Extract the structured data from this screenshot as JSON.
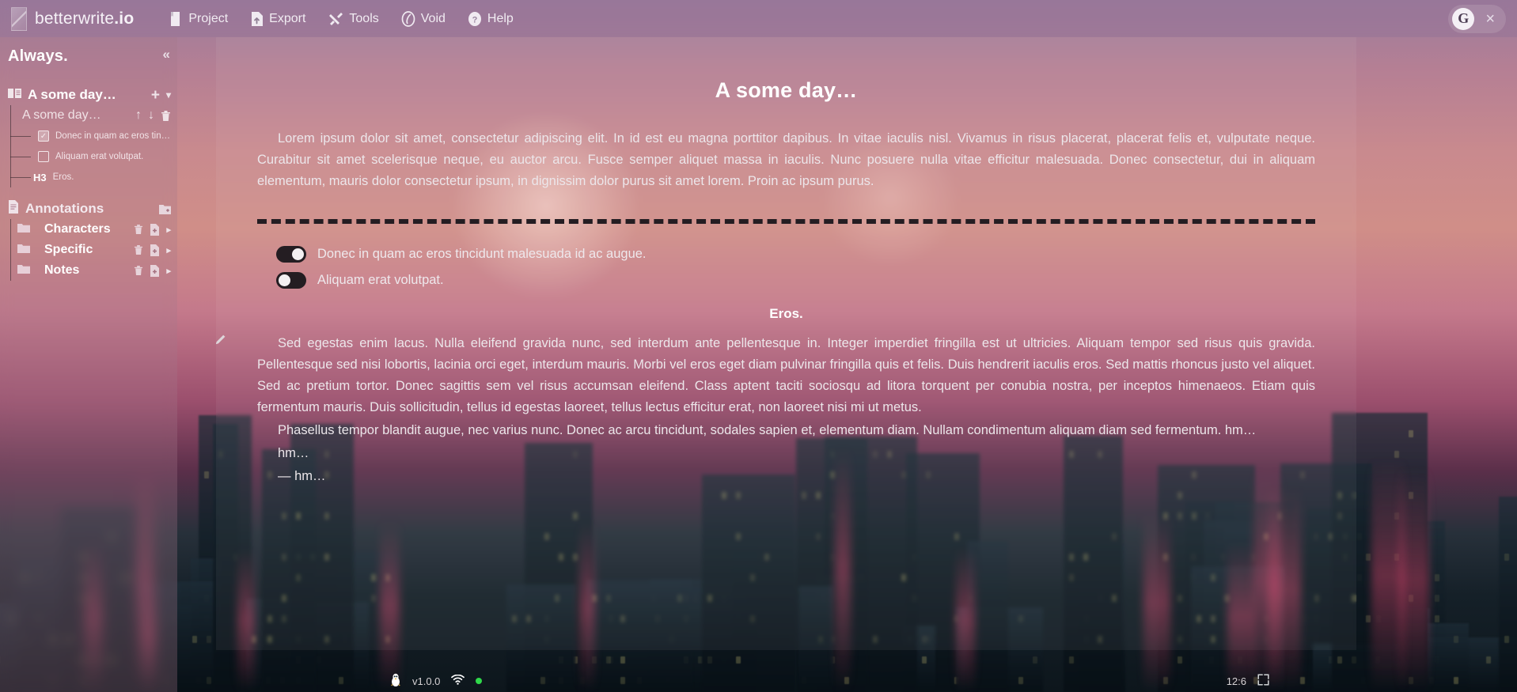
{
  "app": {
    "brand_prefix": "betterwrite",
    "brand_suffix": ".io",
    "brand_logo": "logo-mark"
  },
  "topbar": {
    "menus": [
      {
        "label": "Project",
        "icon": "book-document-icon"
      },
      {
        "label": "Export",
        "icon": "file-upload-icon"
      },
      {
        "label": "Tools",
        "icon": "tools-hammer-wrench-icon"
      },
      {
        "label": "Void",
        "icon": "void-circle-icon"
      },
      {
        "label": "Help",
        "icon": "question-help-icon"
      }
    ],
    "account_initial": "G",
    "close_label": "×"
  },
  "sidebar": {
    "title": "Always.",
    "collapse_label": "«",
    "project": {
      "name": "A some day…",
      "icon": "open-book-icon",
      "add_label": "+",
      "dropdown_label": "▾"
    },
    "page": {
      "name": "A some day…",
      "move_up_label": "↑",
      "move_down_label": "↓",
      "delete_label": "delete-icon"
    },
    "entities": [
      {
        "type": "checkbox",
        "checked": true,
        "label": "Donec in quam ac eros tin…"
      },
      {
        "type": "checkbox",
        "checked": false,
        "label": "Aliquam erat volutpat."
      },
      {
        "type": "heading",
        "tag": "H3",
        "label": "Eros."
      }
    ],
    "annotations": {
      "title": "Annotations",
      "icon": "document-icon",
      "add_label": "add-folder-icon",
      "folders": [
        {
          "label": "Characters",
          "icon": "folder-icon",
          "delete": "delete-icon",
          "add": "add-file-icon",
          "expand": "▸"
        },
        {
          "label": "Specific",
          "icon": "folder-icon",
          "delete": "delete-icon",
          "add": "add-file-icon",
          "expand": "▸"
        },
        {
          "label": "Notes",
          "icon": "folder-icon",
          "delete": "delete-icon",
          "add": "add-file-icon",
          "expand": "▸"
        }
      ]
    }
  },
  "document": {
    "title": "A some day…",
    "paragraph_1": "Lorem ipsum dolor sit amet, consectetur adipiscing elit. In id est eu magna porttitor dapibus. In vitae iaculis nisl. Vivamus in risus placerat, placerat felis et, vulputate neque. Curabitur sit amet scelerisque neque, eu auctor arcu. Fusce semper aliquet massa in iaculis. Nunc posuere nulla vitae efficitur malesuada. Donec consectetur, dui in aliquam elementum, mauris dolor consectetur ipsum, in dignissim dolor purus sit amet lorem. Proin ac ipsum purus.",
    "checkboxes": [
      {
        "checked": true,
        "label": "Donec in quam ac eros tincidunt malesuada id ac augue."
      },
      {
        "checked": false,
        "label": "Aliquam erat volutpat."
      }
    ],
    "heading_3": "Eros.",
    "paragraph_2": "Sed egestas enim lacus. Nulla eleifend gravida nunc, sed interdum ante pellentesque in. Integer imperdiet fringilla est ut ultricies. Aliquam tempor sed risus quis gravida. Pellentesque sed nisi lobortis, lacinia orci eget, interdum mauris. Morbi vel eros eget diam pulvinar fringilla quis et felis. Duis hendrerit iaculis eros. Sed mattis rhoncus justo vel aliquet. Sed ac pretium tortor. Donec sagittis sem vel risus accumsan eleifend. Class aptent taciti sociosqu ad litora torquent per conubia nostra, per inceptos himenaeos. Etiam quis fermentum mauris. Duis sollicitudin, tellus id egestas laoreet, tellus lectus efficitur erat, non laoreet nisi mi ut metus.",
    "paragraph_3": "Phasellus tempor blandit augue, nec varius nunc. Donec ac arcu tincidunt, sodales sapien et, elementum diam. Nullam condimentum aliquam diam sed fermentum. hm…",
    "paragraph_4": "hm…",
    "paragraph_5": "— hm…",
    "gutter": {
      "comment": "comment-icon",
      "edit": "pencil-edit-icon"
    }
  },
  "statusbar": {
    "os_icon": "linux-penguin-icon",
    "version": "v1.0.0",
    "network_icon": "wifi-icon",
    "status_color": "#2fd84a",
    "cursor_position": "12:6",
    "fullscreen_icon": "fullscreen-icon"
  }
}
